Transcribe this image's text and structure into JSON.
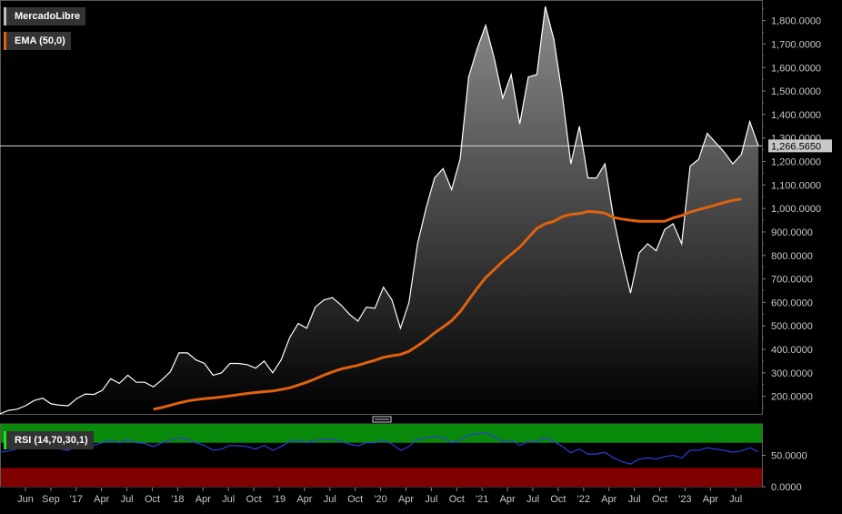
{
  "colors": {
    "background": "#000000",
    "price_line": "#ffffff",
    "price_area_top": "#8c8c8c",
    "price_area_bottom": "#000000",
    "ema_line": "#e0620e",
    "rsi_line": "#2a3ed8",
    "rsi_overbought_zone": "#0a8a0a",
    "rsi_oversold_zone": "#800000",
    "rsi_legend_swatch": "#23e023",
    "axis_text": "#c8c8c8",
    "last_price_badge": "#c8c8c8"
  },
  "legend": {
    "price": "MercadoLibre",
    "ema": "EMA (50,0)",
    "rsi": "RSI (14,70,30,1)"
  },
  "last_price_label": "1,266.5650",
  "chart_data": [
    {
      "type": "area",
      "series": [
        {
          "name": "MercadoLibre",
          "values": [
            125,
            140,
            145,
            160,
            182,
            192,
            168,
            162,
            160,
            190,
            210,
            208,
            225,
            275,
            255,
            290,
            260,
            260,
            240,
            270,
            305,
            385,
            385,
            355,
            340,
            290,
            300,
            340,
            340,
            335,
            320,
            350,
            300,
            355,
            450,
            510,
            490,
            580,
            610,
            620,
            590,
            550,
            520,
            580,
            575,
            665,
            610,
            490,
            600,
            850,
            1000,
            1130,
            1170,
            1080,
            1210,
            1560,
            1680,
            1780,
            1640,
            1470,
            1570,
            1360,
            1560,
            1570,
            1860,
            1720,
            1480,
            1190,
            1350,
            1130,
            1130,
            1190,
            960,
            790,
            640,
            810,
            850,
            820,
            910,
            935,
            850,
            1180,
            1210,
            1320,
            1280,
            1240,
            1190,
            1230,
            1370,
            1266.565
          ]
        },
        {
          "name": "EMA (50,0)",
          "values": [
            null,
            null,
            null,
            null,
            null,
            null,
            null,
            null,
            null,
            null,
            null,
            null,
            null,
            null,
            null,
            null,
            null,
            null,
            145,
            152,
            162,
            172,
            180,
            186,
            190,
            193,
            197,
            202,
            207,
            212,
            216,
            220,
            223,
            229,
            236,
            248,
            260,
            274,
            290,
            304,
            316,
            324,
            332,
            343,
            353,
            366,
            373,
            378,
            392,
            415,
            440,
            470,
            495,
            522,
            560,
            610,
            660,
            705,
            740,
            775,
            805,
            835,
            875,
            915,
            935,
            945,
            965,
            975,
            978,
            987,
            985,
            980,
            962,
            955,
            950,
            945,
            945,
            945,
            945,
            960,
            970,
            985,
            995,
            1005,
            1015,
            1025,
            1035,
            1040
          ]
        }
      ],
      "y_axis_ticks": [
        "200.0000",
        "300.0000",
        "400.0000",
        "500.0000",
        "600.0000",
        "700.0000",
        "800.0000",
        "900.0000",
        "1,000.0000",
        "1,100.0000",
        "1,200.0000",
        "1,300.0000",
        "1,400.0000",
        "1,500.0000",
        "1,600.0000",
        "1,700.0000",
        "1,800.0000"
      ],
      "ylim": [
        125,
        1880
      ],
      "x_axis_labels": [
        "Jun",
        "Sep",
        "'17",
        "Apr",
        "Jul",
        "Oct",
        "'18",
        "Apr",
        "Jul",
        "Oct",
        "'19",
        "Apr",
        "Jul",
        "Oct",
        "'20",
        "Apr",
        "Jul",
        "Oct",
        "'21",
        "Apr",
        "Jul",
        "Oct",
        "'22",
        "Apr",
        "Jul",
        "Oct",
        "'23",
        "Apr",
        "Jul"
      ],
      "grid": false,
      "legend_position": "top-left"
    },
    {
      "type": "line",
      "series": [
        {
          "name": "RSI (14,70,30,1)",
          "values": [
            55,
            57,
            60,
            65,
            68,
            70,
            66,
            60,
            58,
            65,
            68,
            66,
            70,
            74,
            70,
            75,
            70,
            69,
            64,
            70,
            74,
            78,
            76,
            70,
            66,
            58,
            60,
            66,
            65,
            64,
            60,
            66,
            58,
            64,
            72,
            74,
            70,
            74,
            76,
            76,
            72,
            68,
            65,
            70,
            70,
            74,
            68,
            58,
            64,
            76,
            78,
            80,
            78,
            70,
            74,
            82,
            84,
            86,
            80,
            72,
            74,
            66,
            72,
            72,
            78,
            72,
            64,
            54,
            60,
            52,
            52,
            55,
            46,
            40,
            36,
            44,
            46,
            44,
            48,
            50,
            46,
            58,
            58,
            62,
            60,
            58,
            55,
            57,
            62,
            56
          ]
        }
      ],
      "y_axis_ticks": [
        "0.0000",
        "50.0000"
      ],
      "ylim": [
        0,
        100
      ],
      "bands": {
        "overbought": 70,
        "oversold": 30
      }
    }
  ]
}
